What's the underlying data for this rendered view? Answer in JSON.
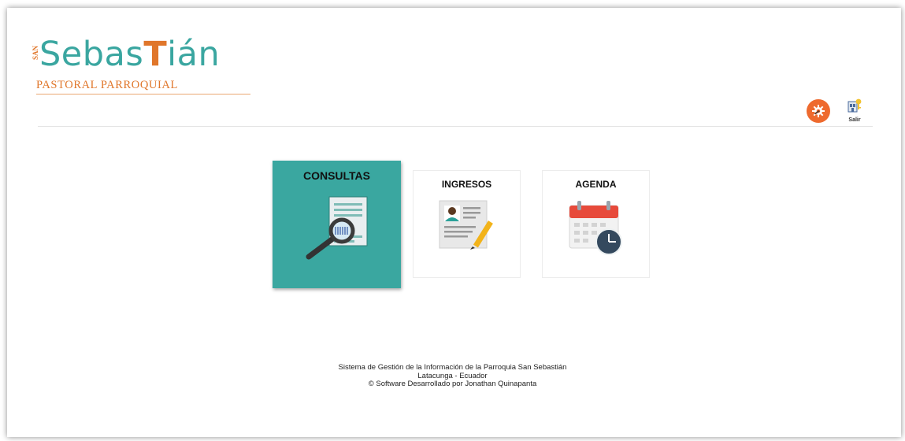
{
  "brand": {
    "side_text": "SAN",
    "word_pre": "Sebas",
    "word_t": "T",
    "word_post": "ián",
    "subtitle": "PASTORAL PARROQUIAL"
  },
  "header": {
    "settings_icon": "gear-icon",
    "exit_label": "Salir",
    "exit_icon": "exit-key-icon"
  },
  "tiles": [
    {
      "label": "CONSULTAS",
      "icon": "document-search-icon",
      "active": true
    },
    {
      "label": "INGRESOS",
      "icon": "id-card-pencil-icon",
      "active": false
    },
    {
      "label": "AGENDA",
      "icon": "calendar-clock-icon",
      "active": false
    }
  ],
  "colors": {
    "brand_teal": "#3aa7a0",
    "brand_orange": "#e0762a",
    "settings_orange": "#ee6a2e"
  },
  "footer": {
    "line1": "Sistema de Gestión de la Información de la Parroquia San Sebastián",
    "line2": "Latacunga - Ecuador",
    "line3": "© Software Desarrollado por Jonathan Quinapanta"
  }
}
